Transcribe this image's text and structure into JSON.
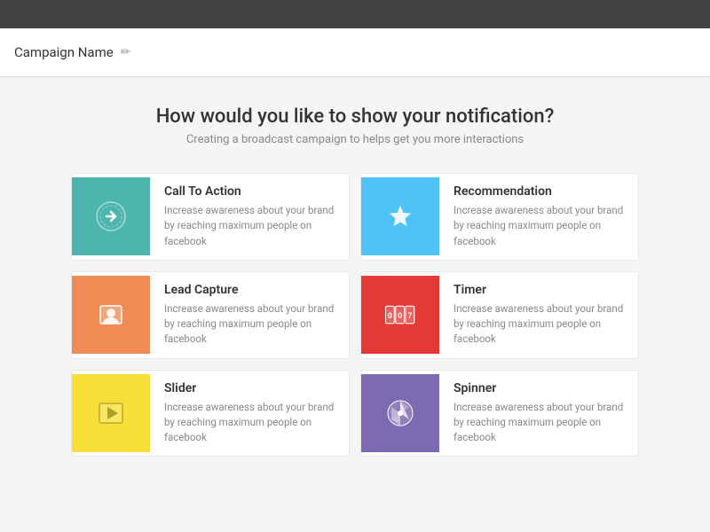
{
  "topbar": {},
  "header": {
    "campaign_name": "Campaign Name",
    "edit_icon": "✏"
  },
  "main": {
    "title": "How would you like to show your notification?",
    "subtitle": "Creating a broadcast campaign to helps get you more interactions",
    "cards": [
      {
        "id": "call-to-action",
        "title": "Call To Action",
        "description": "Increase awareness about your brand by reaching maximum people on facebook",
        "icon_color": "teal",
        "icon_type": "arrow"
      },
      {
        "id": "recommendation",
        "title": "Recommendation",
        "description": "Increase awareness about your brand by reaching maximum people on facebook",
        "icon_color": "blue",
        "icon_type": "star"
      },
      {
        "id": "lead-capture",
        "title": "Lead Capture",
        "description": "Increase awareness about your brand by reaching maximum people on facebook",
        "icon_color": "orange",
        "icon_type": "person"
      },
      {
        "id": "timer",
        "title": "Timer",
        "description": "Increase awareness about your brand by reaching maximum people on facebook",
        "icon_color": "red",
        "icon_type": "timer"
      },
      {
        "id": "slider",
        "title": "Slider",
        "description": "Increase awareness about your brand by reaching maximum people on facebook",
        "icon_color": "yellow",
        "icon_type": "play"
      },
      {
        "id": "spinner",
        "title": "Spinner",
        "description": "Increase awareness about your brand by reaching maximum people on facebook",
        "icon_color": "purple",
        "icon_type": "spinner"
      }
    ]
  }
}
